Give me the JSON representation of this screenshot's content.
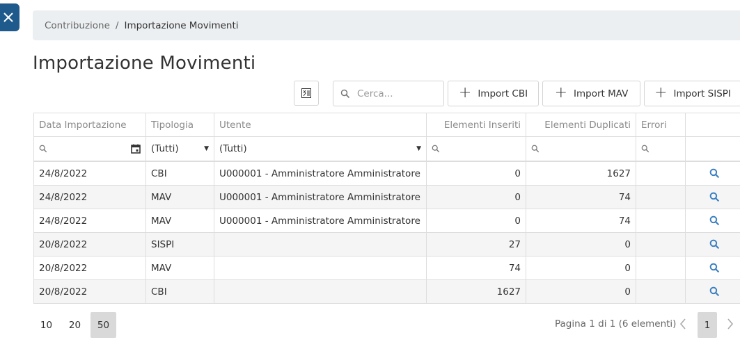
{
  "breadcrumb": {
    "parent": "Contribuzione",
    "separator": "/",
    "current": "Importazione Movimenti"
  },
  "page_title": "Importazione Movimenti",
  "toolbar": {
    "search_placeholder": "Cerca...",
    "buttons": [
      "Import CBI",
      "Import MAV",
      "Import SISPI"
    ]
  },
  "grid": {
    "columns": [
      "Data Importazione",
      "Tipologia",
      "Utente",
      "Elementi Inseriti",
      "Elementi Duplicati",
      "Errori",
      ""
    ],
    "filters": {
      "tipologia": "(Tutti)",
      "utente": "(Tutti)"
    },
    "rows": [
      {
        "data": "24/8/2022",
        "tipologia": "CBI",
        "utente": "U000001 - Amministratore Amministratore",
        "inseriti": "0",
        "duplicati": "1627",
        "errori": ""
      },
      {
        "data": "24/8/2022",
        "tipologia": "MAV",
        "utente": "U000001 - Amministratore Amministratore",
        "inseriti": "0",
        "duplicati": "74",
        "errori": ""
      },
      {
        "data": "24/8/2022",
        "tipologia": "MAV",
        "utente": "U000001 - Amministratore Amministratore",
        "inseriti": "0",
        "duplicati": "74",
        "errori": ""
      },
      {
        "data": "20/8/2022",
        "tipologia": "SISPI",
        "utente": "",
        "inseriti": "27",
        "duplicati": "0",
        "errori": ""
      },
      {
        "data": "20/8/2022",
        "tipologia": "MAV",
        "utente": "",
        "inseriti": "74",
        "duplicati": "0",
        "errori": ""
      },
      {
        "data": "20/8/2022",
        "tipologia": "CBI",
        "utente": "",
        "inseriti": "1627",
        "duplicati": "0",
        "errori": ""
      }
    ]
  },
  "pager": {
    "page_sizes": [
      "10",
      "20",
      "50"
    ],
    "selected_page_size": "50",
    "info": "Pagina 1 di 1 (6 elementi)",
    "current_page": "1"
  },
  "colors": {
    "accent": "#1f5a8c",
    "link_icon": "#3a7fc1",
    "breadcrumb_bg": "#eceff1",
    "alt_row": "#f5f5f5"
  },
  "icons": [
    "close-icon",
    "excel-export-icon",
    "search-icon",
    "plus-icon",
    "calendar-icon",
    "caret-down-icon",
    "chevron-left-icon",
    "chevron-right-icon"
  ]
}
